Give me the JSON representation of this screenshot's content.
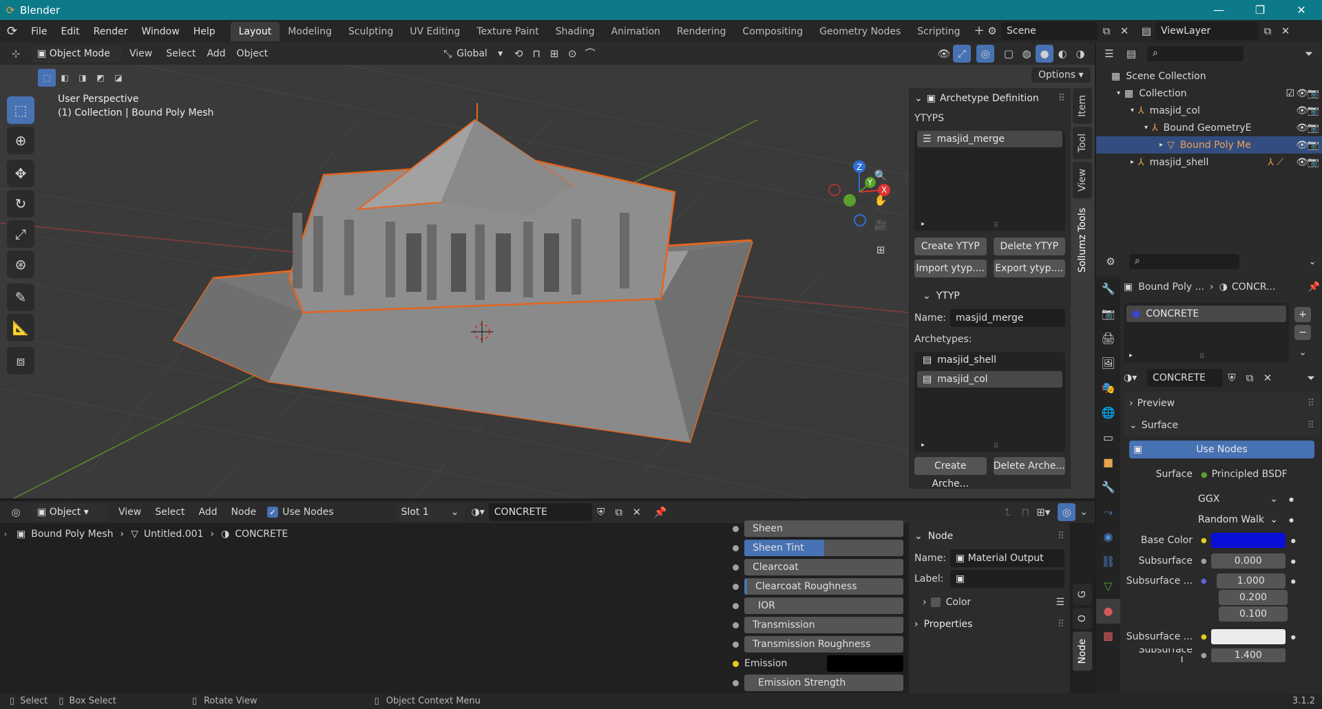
{
  "window": {
    "app_title": "Blender",
    "version": "3.1.2"
  },
  "menu": {
    "items": [
      "File",
      "Edit",
      "Render",
      "Window",
      "Help"
    ]
  },
  "workspace_tabs": [
    "Layout",
    "Modeling",
    "Sculpting",
    "UV Editing",
    "Texture Paint",
    "Shading",
    "Animation",
    "Rendering",
    "Compositing",
    "Geometry Nodes",
    "Scripting"
  ],
  "active_tab": "Layout",
  "scene": {
    "name": "Scene",
    "view_layer": "ViewLayer"
  },
  "viewport_header": {
    "mode": "Object Mode",
    "menus": [
      "View",
      "Select",
      "Add",
      "Object"
    ],
    "orientation": "Global",
    "options_label": "Options"
  },
  "viewport": {
    "perspective": "User Perspective",
    "context": "(1) Collection | Bound Poly Mesh",
    "gizmo_axes": [
      "Z",
      "Y",
      "X"
    ]
  },
  "npanel": {
    "archetype_title": "Archetype Definition",
    "ytyps_label": "YTYPS",
    "ytyp_items": [
      "masjid_merge"
    ],
    "btn_create_ytyp": "Create YTYP",
    "btn_delete_ytyp": "Delete YTYP",
    "btn_import_ytyp": "Import ytyp....",
    "btn_export_ytyp": "Export ytyp....",
    "ytyp_section": "YTYP",
    "name_label": "Name:",
    "name_value": "masjid_merge",
    "archetypes_label": "Archetypes:",
    "archetype_items": [
      "masjid_shell",
      "masjid_col"
    ],
    "btn_create_arche": "Create Arche...",
    "btn_delete_arche": "Delete Arche...",
    "tabs": [
      "Item",
      "Tool",
      "View",
      "Sollumz Tools"
    ]
  },
  "outliner": {
    "rows": [
      {
        "label": "Scene Collection",
        "indent": 0
      },
      {
        "label": "Collection",
        "indent": 1
      },
      {
        "label": "masjid_col",
        "indent": 2
      },
      {
        "label": "Bound GeometryE",
        "indent": 3
      },
      {
        "label": "Bound Poly Me",
        "indent": 4
      },
      {
        "label": "masjid_shell",
        "indent": 2
      }
    ]
  },
  "properties": {
    "breadcrumb_obj": "Bound Poly ...",
    "breadcrumb_mat": "CONCR...",
    "slot_material": "CONCRETE",
    "material_name": "CONCRETE",
    "preview_label": "Preview",
    "surface_section": "Surface",
    "use_nodes_btn": "Use Nodes",
    "surface_label": "Surface",
    "surface_value": "Principled BSDF",
    "distribution": "GGX",
    "subsurface_method": "Random Walk",
    "base_color_label": "Base Color",
    "base_color": "#0a10d8",
    "subsurface_label": "Subsurface",
    "subsurface_value": "0.000",
    "subsurface_radius_label": "Subsurface ...",
    "subsurface_radius": [
      "1.000",
      "0.200",
      "0.100"
    ],
    "subsurface_color_label": "Subsurface ...",
    "subsurface_ior_label": "Subsurface I...",
    "subsurface_ior_value": "1.400"
  },
  "node_editor": {
    "header": {
      "editor": "Object",
      "menus": [
        "View",
        "Select",
        "Add",
        "Node"
      ],
      "use_nodes": "Use Nodes",
      "slot": "Slot 1",
      "material": "CONCRETE"
    },
    "breadcrumb": [
      "Bound Poly Mesh",
      "Untitled.001",
      "CONCRETE"
    ],
    "inputs": [
      "Sheen",
      "Sheen Tint",
      "Clearcoat",
      "Clearcoat Roughness",
      "IOR",
      "Transmission",
      "Transmission Roughness",
      "Emission",
      "Emission Strength"
    ],
    "sheen_tint_fill": 0.5,
    "node_panel": {
      "title": "Node",
      "name_label": "Name:",
      "name_value": "Material Output",
      "label_label": "Label:",
      "color_label": "Color",
      "properties_label": "Properties"
    },
    "side_tabs": [
      "Node",
      "O",
      "G"
    ]
  },
  "statusbar": {
    "items": [
      "Select",
      "Box Select",
      "Rotate View",
      "Object Context Menu"
    ]
  }
}
